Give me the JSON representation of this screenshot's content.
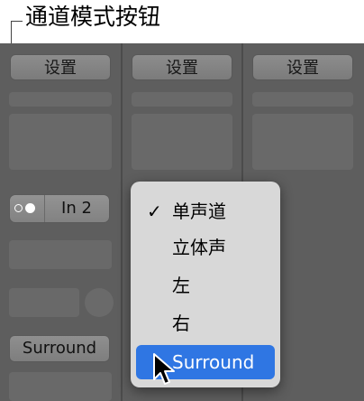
{
  "callout": {
    "text": "通道模式按钮"
  },
  "strips": [
    {
      "setting_label": "设置"
    },
    {
      "setting_label": "设置"
    },
    {
      "setting_label": "设置"
    }
  ],
  "channel_mode": {
    "input_label": "In 2",
    "icon": "mono-stereo-circles-icon"
  },
  "surround_button": {
    "label": "Surround"
  },
  "menu": {
    "items": [
      {
        "label": "单声道",
        "checked": true
      },
      {
        "label": "立体声"
      },
      {
        "label": "左"
      },
      {
        "label": "右"
      },
      {
        "label": "Surround",
        "highlighted": true
      }
    ]
  },
  "colors": {
    "highlight": "#2f76e3",
    "menu_bg": "#d8d8d8",
    "mixer_bg": "#5e5e5e"
  }
}
